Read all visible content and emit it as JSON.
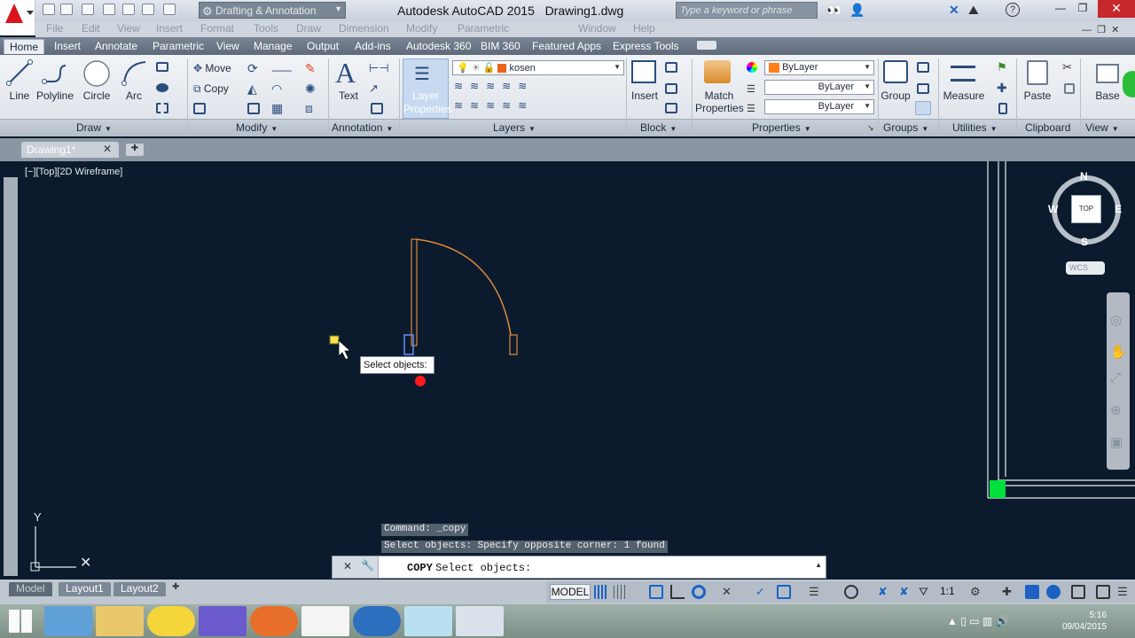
{
  "title_bar": {
    "workspace": "Drafting & Annotation",
    "app_title": "Autodesk AutoCAD 2015",
    "file_name": "Drawing1.dwg",
    "search_placeholder": "Type a keyword or phrase",
    "menu_items": [
      "File",
      "Edit",
      "View",
      "Insert",
      "Format",
      "Tools",
      "Draw",
      "Dimension",
      "Modify",
      "Parametric",
      "Window",
      "Help"
    ]
  },
  "ribbon_tabs": [
    "Home",
    "Insert",
    "Annotate",
    "Parametric",
    "View",
    "Manage",
    "Output",
    "Add-ins",
    "Autodesk 360",
    "BIM 360",
    "Featured Apps",
    "Express Tools"
  ],
  "ribbon": {
    "draw": {
      "label": "Draw",
      "line": "Line",
      "polyline": "Polyline",
      "circle": "Circle",
      "arc": "Arc"
    },
    "modify": {
      "label": "Modify",
      "move": "Move",
      "copy": "Copy"
    },
    "annotation": {
      "label": "Annotation",
      "text": "Text"
    },
    "layers": {
      "label": "Layers",
      "layer_properties_1": "Layer",
      "layer_properties_2": "Properties",
      "current_layer": "kosen"
    },
    "block": {
      "label": "Block",
      "insert": "Insert"
    },
    "properties": {
      "label": "Properties",
      "match_1": "Match",
      "match_2": "Properties",
      "color": "ByLayer",
      "linetype": "ByLayer",
      "lineweight": "ByLayer"
    },
    "groups": {
      "label": "Groups",
      "group": "Group"
    },
    "utilities": {
      "label": "Utilities",
      "measure": "Measure"
    },
    "clipboard": {
      "label": "Clipboard",
      "paste": "Paste"
    },
    "view": {
      "label": "View",
      "base": "Base"
    }
  },
  "document": {
    "tab": "Drawing1*"
  },
  "viewport": {
    "label": "[−][Top][2D Wireframe]",
    "viewcube": {
      "n": "N",
      "s": "S",
      "e": "E",
      "w": "W",
      "face": "TOP",
      "ucs": "WCS"
    },
    "ucs_y": "Y",
    "tooltip": "Select objects:"
  },
  "command": {
    "history_1": "Command: _copy",
    "history_2": "Select objects: Specify opposite corner: 1 found",
    "prompt_cmd": "COPY",
    "prompt_text": "Select objects:"
  },
  "layout_tabs": [
    "Model",
    "Layout1",
    "Layout2"
  ],
  "status": {
    "model": "MODEL",
    "scale": "1:1"
  },
  "taskbar": {
    "clock_time": "5:16",
    "clock_date": "09/04/2015"
  },
  "colors": {
    "door": "#e0883a",
    "grip": "#00e03c",
    "accent": "#d9141c"
  }
}
